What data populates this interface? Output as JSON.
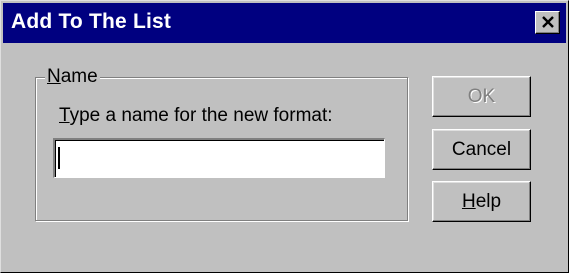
{
  "window": {
    "title": "Add To The List",
    "close_icon": "close-icon"
  },
  "group": {
    "legend_mnemonic": "N",
    "legend_rest": "ame",
    "prompt_mnemonic": "T",
    "prompt_rest": "ype a name for the new format:"
  },
  "name_input": {
    "value": ""
  },
  "buttons": {
    "ok": {
      "label": "OK",
      "enabled": false
    },
    "cancel": {
      "label": "Cancel"
    },
    "help_mnemonic": "H",
    "help_rest": "elp"
  },
  "colors": {
    "titlebar": "#000080",
    "face": "#c0c0c0",
    "disabled_text": "#808080"
  }
}
